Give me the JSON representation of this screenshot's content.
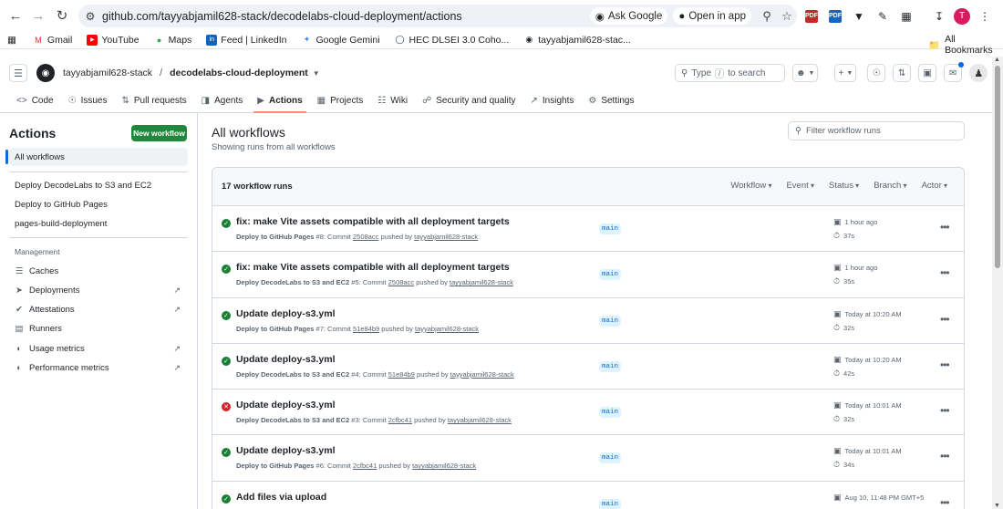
{
  "browser": {
    "url": "github.com/tayyabjamil628-stack/decodelabs-cloud-deployment/actions",
    "ask_google": "Ask Google",
    "open_in_app": "Open in app",
    "profile_initial": "T",
    "ext_pdf": "PDF",
    "ext_pdf2": "PDF"
  },
  "bookmarks": {
    "items": [
      {
        "label": "Gmail"
      },
      {
        "label": "YouTube"
      },
      {
        "label": "Maps"
      },
      {
        "label": "Feed | LinkedIn"
      },
      {
        "label": "Google Gemini"
      },
      {
        "label": "HEC DLSEI 3.0 Coho..."
      },
      {
        "label": "tayyabjamil628-stac..."
      }
    ],
    "all_bookmarks": "All Bookmarks"
  },
  "header": {
    "owner": "tayyabjamil628-stack",
    "separator": "/",
    "repo": "decodelabs-cloud-deployment",
    "search_prefix": "Type",
    "search_key": "/",
    "search_suffix": "to search",
    "plus": "+"
  },
  "tabs": [
    {
      "label": "Code"
    },
    {
      "label": "Issues"
    },
    {
      "label": "Pull requests"
    },
    {
      "label": "Agents"
    },
    {
      "label": "Actions"
    },
    {
      "label": "Projects"
    },
    {
      "label": "Wiki"
    },
    {
      "label": "Security and quality"
    },
    {
      "label": "Insights"
    },
    {
      "label": "Settings"
    }
  ],
  "sidebar": {
    "title": "Actions",
    "new_workflow": "New workflow",
    "all_workflows": "All workflows",
    "workflows": [
      {
        "label": "Deploy DecodeLabs to S3 and EC2"
      },
      {
        "label": "Deploy to GitHub Pages"
      },
      {
        "label": "pages-build-deployment"
      }
    ],
    "management_heading": "Management",
    "management": [
      {
        "label": "Caches",
        "external": ""
      },
      {
        "label": "Deployments",
        "external": "↗"
      },
      {
        "label": "Attestations",
        "external": "↗"
      },
      {
        "label": "Runners",
        "external": ""
      },
      {
        "label": "Usage metrics",
        "external": "↗"
      },
      {
        "label": "Performance metrics",
        "external": "↗"
      }
    ]
  },
  "main": {
    "title": "All workflows",
    "subtitle": "Showing runs from all workflows",
    "filter_placeholder": "Filter workflow runs",
    "runs_count": "17 workflow runs",
    "filters": [
      "Workflow",
      "Event",
      "Status",
      "Branch",
      "Actor"
    ],
    "runs": [
      {
        "status": "success",
        "title": "fix: make Vite assets compatible with all deployment targets",
        "workflow": "Deploy to GitHub Pages",
        "run_no": "#8",
        "commit": "2508acc",
        "pusher": "tayyabjamil628-stack",
        "branch": "main",
        "when": "1 hour ago",
        "duration": "37s"
      },
      {
        "status": "success",
        "title": "fix: make Vite assets compatible with all deployment targets",
        "workflow": "Deploy DecodeLabs to S3 and EC2",
        "run_no": "#5",
        "commit": "2508acc",
        "pusher": "tayyabjamil628-stack",
        "branch": "main",
        "when": "1 hour ago",
        "duration": "35s"
      },
      {
        "status": "success",
        "title": "Update deploy-s3.yml",
        "workflow": "Deploy to GitHub Pages",
        "run_no": "#7",
        "commit": "51e84b9",
        "pusher": "tayyabjamil628-stack",
        "branch": "main",
        "when": "Today at 10:20 AM",
        "duration": "32s"
      },
      {
        "status": "success",
        "title": "Update deploy-s3.yml",
        "workflow": "Deploy DecodeLabs to S3 and EC2",
        "run_no": "#4",
        "commit": "51e84b9",
        "pusher": "tayyabjamil628-stack",
        "branch": "main",
        "when": "Today at 10:20 AM",
        "duration": "42s"
      },
      {
        "status": "failure",
        "title": "Update deploy-s3.yml",
        "workflow": "Deploy DecodeLabs to S3 and EC2",
        "run_no": "#3",
        "commit": "2cfbc41",
        "pusher": "tayyabjamil628-stack",
        "branch": "main",
        "when": "Today at 10:01 AM",
        "duration": "32s"
      },
      {
        "status": "success",
        "title": "Update deploy-s3.yml",
        "workflow": "Deploy to GitHub Pages",
        "run_no": "#6",
        "commit": "2cfbc41",
        "pusher": "tayyabjamil628-stack",
        "branch": "main",
        "when": "Today at 10:01 AM",
        "duration": "34s"
      },
      {
        "status": "success",
        "title": "Add files via upload",
        "workflow": "",
        "run_no": "",
        "commit": "",
        "pusher": "",
        "branch": "main",
        "when": "Aug 10, 11:48 PM GMT+5",
        "duration": ""
      }
    ],
    "meta_commit": "Commit",
    "meta_pushed_by": "pushed by"
  },
  "colors": {
    "success": "#1a7f37",
    "failure": "#cf222e",
    "primary_button": "#1f883d",
    "accent_underline": "#fd8c73",
    "link": "#0969da"
  }
}
